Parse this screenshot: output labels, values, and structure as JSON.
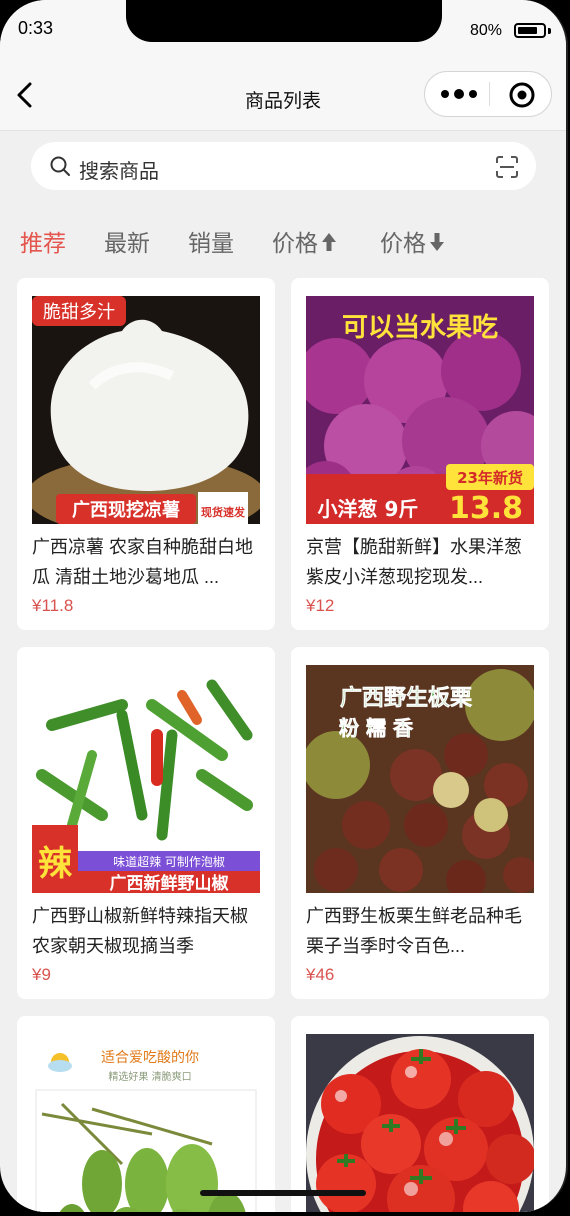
{
  "status": {
    "time": "0:33",
    "battery": "80%",
    "battery_level": 0.8
  },
  "nav": {
    "title": "商品列表"
  },
  "search": {
    "placeholder": "搜索商品"
  },
  "tabs": [
    "推荐",
    "最新",
    "销量",
    "价格",
    "价格"
  ],
  "products": [
    {
      "title": "广西凉薯 农家自种脆甜白地瓜 清甜土地沙葛地瓜 ...",
      "price": "¥11.8",
      "img_tag": "脆甜多汁",
      "img_banner": "广西现挖凉薯",
      "img_badge": "现货速发"
    },
    {
      "title": "京营【脆甜新鲜】水果洋葱 紫皮小洋葱现挖现发...",
      "price": "¥12",
      "img_tag": "可以当水果吃",
      "img_banner": "小洋葱 9斤",
      "img_badge": "23年新货",
      "img_price": "13.8"
    },
    {
      "title": "广西野山椒新鲜特辣指天椒农家朝天椒现摘当季",
      "price": "¥9",
      "img_tag": "辣",
      "img_banner": "广西新鲜野山椒",
      "img_badge": "味道超辣 可制作泡椒"
    },
    {
      "title": "广西野生板栗生鲜老品种毛栗子当季时令百色...",
      "price": "¥46",
      "img_tag": "广西野生板栗",
      "img_badge": "粉 糯 香"
    },
    {
      "title": "",
      "price": "",
      "img_tag": "适合爱吃酸的你",
      "img_badge": "精选好果 清脆爽口"
    },
    {
      "title": "",
      "price": ""
    }
  ]
}
